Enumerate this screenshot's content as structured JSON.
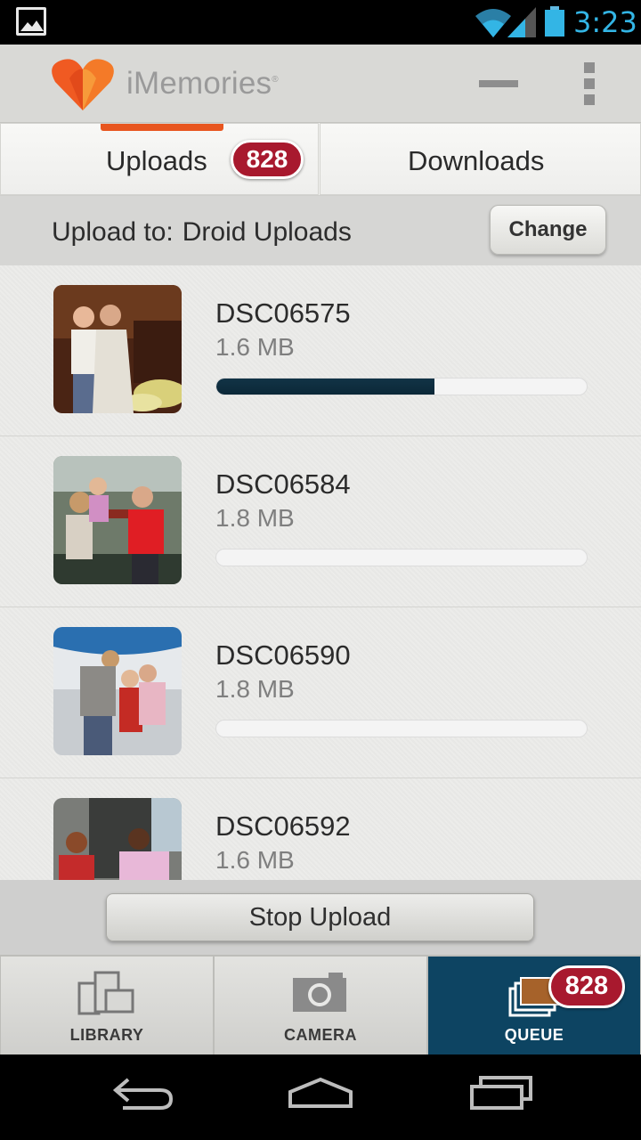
{
  "status_bar": {
    "time": "3:23"
  },
  "app": {
    "brand": "iMemories",
    "trademark": "®"
  },
  "tabs": [
    {
      "label": "Uploads",
      "badge": "828",
      "active": true
    },
    {
      "label": "Downloads",
      "active": false
    }
  ],
  "upload_to": {
    "label": "Upload to:",
    "destination": "Droid Uploads",
    "change_label": "Change"
  },
  "uploads": [
    {
      "name": "DSC06575",
      "size": "1.6 MB",
      "progress": 0.59
    },
    {
      "name": "DSC06584",
      "size": "1.8 MB",
      "progress": 0
    },
    {
      "name": "DSC06590",
      "size": "1.8 MB",
      "progress": 0
    },
    {
      "name": "DSC06592",
      "size": "1.6 MB",
      "progress": 0
    }
  ],
  "stop_upload_label": "Stop Upload",
  "bottom_nav": [
    {
      "label": "LIBRARY",
      "icon": "library-icon",
      "active": false
    },
    {
      "label": "CAMERA",
      "icon": "camera-icon",
      "active": false
    },
    {
      "label": "QUEUE",
      "icon": "queue-icon",
      "active": true,
      "badge": "828"
    }
  ],
  "colors": {
    "accent": "#e8561f",
    "badge": "#a8192e",
    "active_nav": "#0d4462",
    "progress": "#123346",
    "status_blue": "#33b5e5"
  }
}
